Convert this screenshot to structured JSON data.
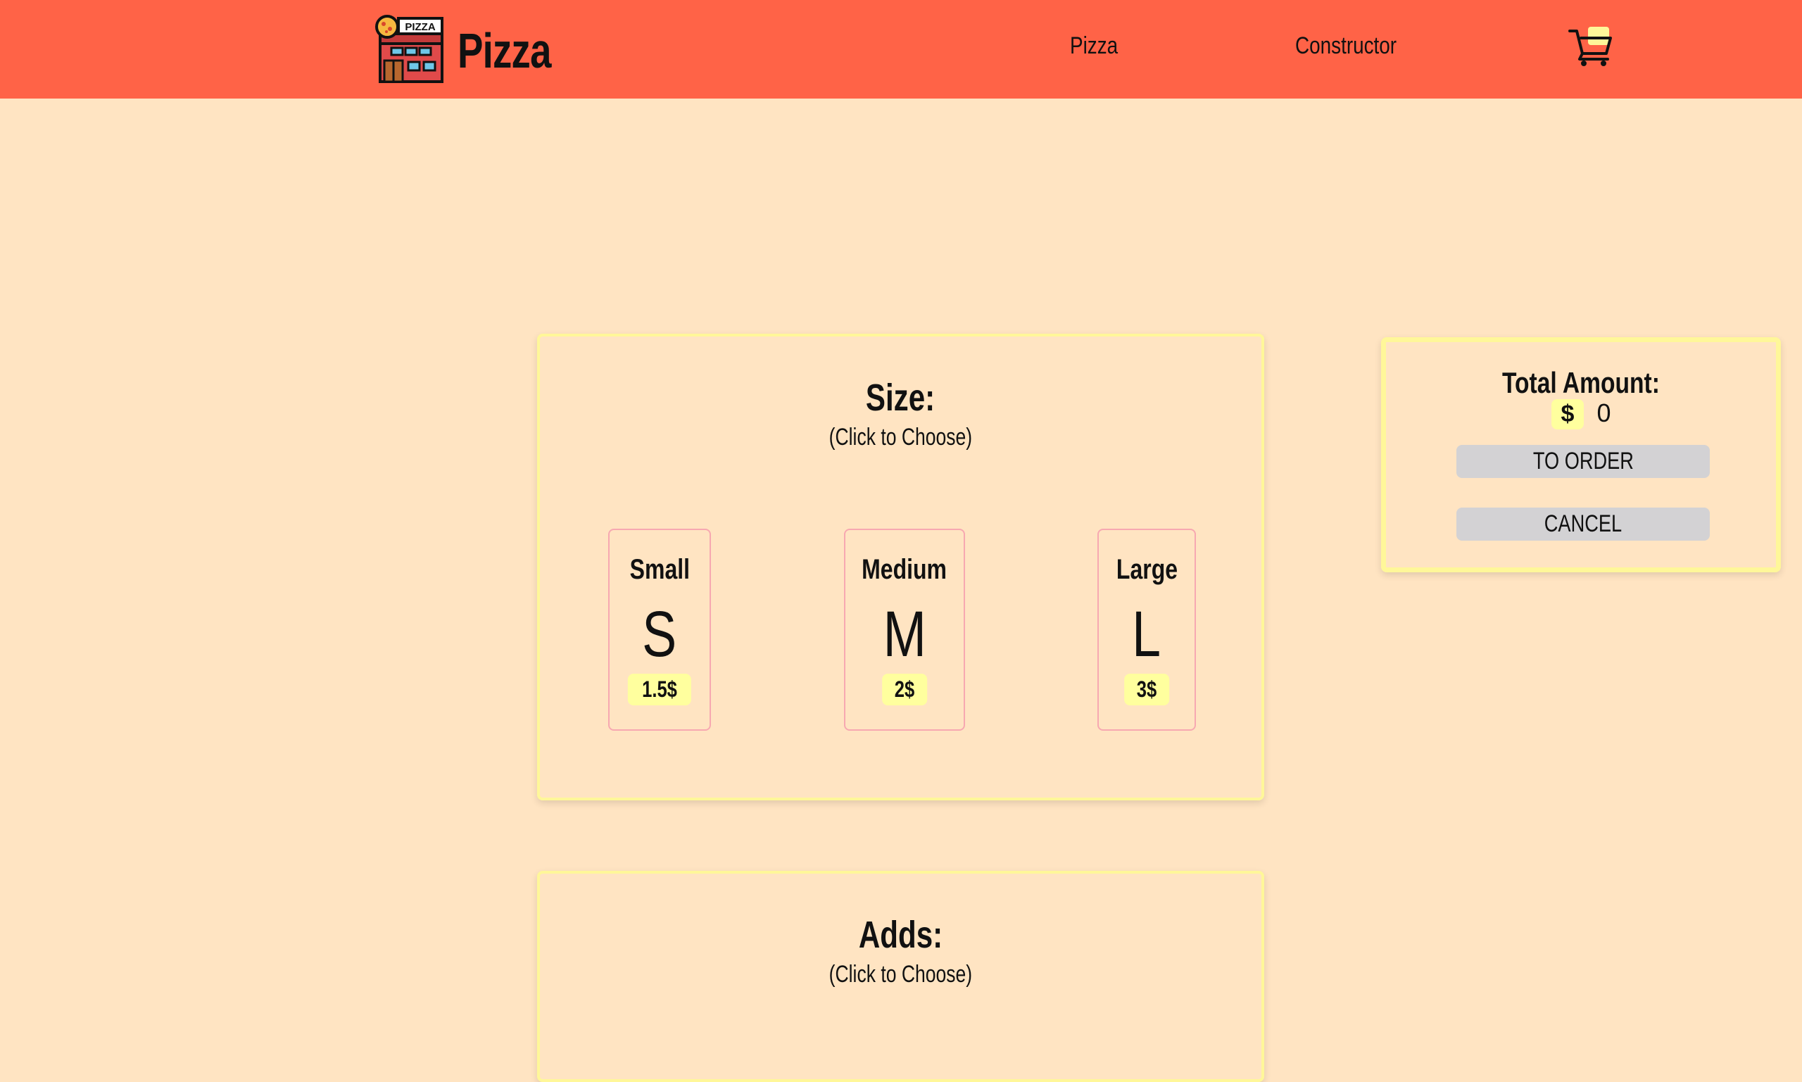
{
  "header": {
    "logo_sign": "PIZZA",
    "brand": "Pizza",
    "nav": [
      "Pizza",
      "Constructor"
    ],
    "accent_color": "#ff6347"
  },
  "size_section": {
    "title": "Size:",
    "subtitle": "(Click to Choose)",
    "options": [
      {
        "name": "Small",
        "letter": "S",
        "price": "1.5$"
      },
      {
        "name": "Medium",
        "letter": "M",
        "price": "2$"
      },
      {
        "name": "Large",
        "letter": "L",
        "price": "3$"
      }
    ]
  },
  "adds_section": {
    "title": "Adds:",
    "subtitle": "(Click to Choose)"
  },
  "order_panel": {
    "label": "Total Amount:",
    "currency": "$",
    "amount": "0",
    "order_button": "TO ORDER",
    "cancel_button": "CANCEL"
  },
  "icons": {
    "logo": "pizza-shop-icon",
    "cart": "shopping-cart-icon"
  },
  "colors": {
    "background": "#ffe4c2",
    "panel_border": "#fff799",
    "card_border": "#f7a8b1",
    "price_badge": "#ffff9e",
    "button": "#d3d2d4"
  }
}
